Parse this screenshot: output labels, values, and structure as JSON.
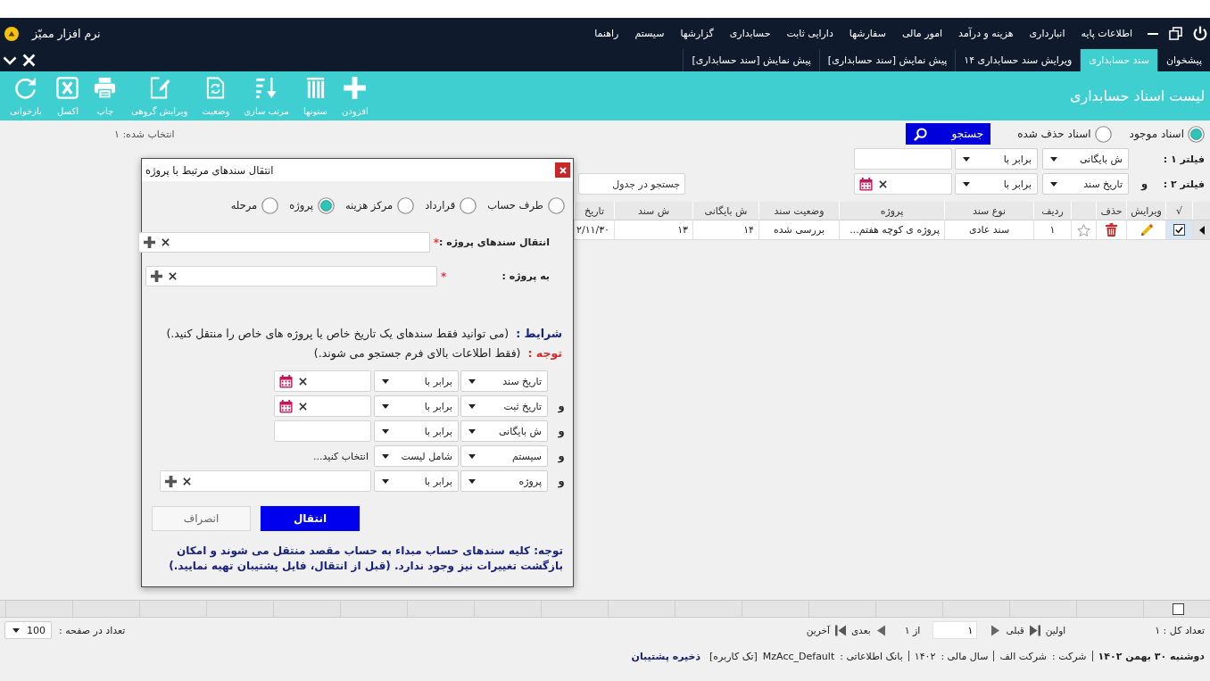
{
  "app": {
    "title": "نرم افزار ممیّز"
  },
  "menu": [
    "اطلاعات پایه",
    "انبارداری",
    "هزینه و درآمد",
    "امور مالی",
    "سفارشها",
    "دارایی ثابت",
    "حسابداری",
    "گزارشها",
    "سیستم",
    "راهنما"
  ],
  "tabs": [
    {
      "label": "پیشخوان",
      "selected": false
    },
    {
      "label": "سند حسابداری",
      "selected": true
    },
    {
      "label": "ویرایش سند حسابداری ۱۴",
      "selected": false
    },
    {
      "label": "پیش نمایش [سند حسابداری]",
      "selected": false
    },
    {
      "label": "پیش نمایش [سند حسابداری]",
      "selected": false
    }
  ],
  "toolbar": {
    "title": "لیست اسناد حسابداری",
    "buttons": [
      {
        "label": "افزودن",
        "kind": "add"
      },
      {
        "label": "ستونها",
        "kind": "columns"
      },
      {
        "label": "مرتب سازی",
        "kind": "sort"
      },
      {
        "label": "وضعیت",
        "kind": "status"
      },
      {
        "label": "ویرایش گروهی",
        "kind": "bulk-edit"
      },
      {
        "label": "چاپ",
        "kind": "print"
      },
      {
        "label": "اکسل",
        "kind": "excel"
      },
      {
        "label": "بازخوانی",
        "kind": "reload"
      }
    ]
  },
  "doc_filter": {
    "options": [
      {
        "label": "اسناد موجود",
        "selected": true
      },
      {
        "label": "اسناد حذف شده",
        "selected": false
      }
    ],
    "search_button": "جستجو",
    "selected_count": "انتخاب شده: ۱"
  },
  "filters": [
    {
      "label": "فیلتر ۱ :",
      "field": "ش بایگانی",
      "operator": "برابر با",
      "kind": "text"
    },
    {
      "label": "فیلتر ۲ :",
      "joiner": "و",
      "field": "تاریخ سند",
      "operator": "برابر با",
      "kind": "date"
    }
  ],
  "table_search": {
    "placeholder": "جستجو در جدول"
  },
  "table": {
    "columns": [
      "√",
      "ویرایش",
      "حذف",
      "",
      "ردیف",
      "نوع سند",
      "پروژه",
      "وضعیت سند",
      "ش بایگانی",
      "ش سند",
      "تاریخ"
    ],
    "rows": [
      {
        "current": true,
        "cells": [
          {
            "kind": "checkbox",
            "checked": true
          },
          {
            "kind": "edit"
          },
          {
            "kind": "delete"
          },
          {
            "kind": "star",
            "starred": false
          },
          "۱",
          "سند عادی",
          "پروژه ی کوچه هفتم...",
          "بررسی شده",
          "۱۴",
          "۱۳",
          "۲/۱۱/۳۰"
        ]
      }
    ],
    "footer_checkbox": {
      "checked": false
    }
  },
  "pager": {
    "total": "تعداد کل : ۱",
    "first": "اولین",
    "previous": "قبلی",
    "page": "۱",
    "page_count": "از ۱",
    "next": "بعدی",
    "last": "آخرین",
    "page_size_label": "تعداد در صفحه :",
    "page_size": "100"
  },
  "status_bar": {
    "date": "دوشنبه ۳۰ بهمن ۱۴۰۲",
    "fields": [
      {
        "label": "شرکت :",
        "value": "شرکت الف"
      },
      {
        "label": "سال مالی :",
        "value": "۱۴۰۲"
      },
      {
        "label": "بانک اطلاعاتی :",
        "value": "MzAcc_Default"
      }
    ],
    "mode": "[تک کاربره]",
    "backup_link": "ذخیره پشتیبان"
  },
  "dialog": {
    "title": "انتقال سندهای مرتبط با پروژه",
    "scope_options": [
      {
        "label": "طرف حساب",
        "selected": false
      },
      {
        "label": "قرارداد",
        "selected": false
      },
      {
        "label": "مرکز هزینه",
        "selected": false
      },
      {
        "label": "پروژه",
        "selected": true
      },
      {
        "label": "مرحله",
        "selected": false
      }
    ],
    "fields": [
      {
        "label": "انتقال سندهای پروژه :",
        "required_mark": "*"
      },
      {
        "label": "به پروژه :",
        "required_mark": "*"
      }
    ],
    "notes": [
      {
        "label": "شرایط :",
        "kind": "condition",
        "text": "(می توانید فقط سندهای یک تاریخ خاص یا پروژه های خاص را منتقل کنید.)"
      },
      {
        "label": "توجه :",
        "kind": "warning",
        "text": "(فقط اطلاعات بالای فرم جستجو می شوند.)"
      }
    ],
    "conditions": [
      {
        "field": "تاریخ سند",
        "operator": "برابر با",
        "kind": "date"
      },
      {
        "joiner": "و",
        "field": "تاریخ ثبت",
        "operator": "برابر با",
        "kind": "date"
      },
      {
        "joiner": "و",
        "field": "ش بایگانی",
        "operator": "برابر با",
        "kind": "text"
      },
      {
        "joiner": "و",
        "field": "سیستم",
        "operator": "شامل لیست",
        "kind": "list",
        "value": "انتخاب کنید..."
      },
      {
        "joiner": "و",
        "field": "پروژه",
        "operator": "برابر با",
        "kind": "lookup"
      }
    ],
    "buttons": [
      {
        "label": "انتقال",
        "kind": "primary"
      },
      {
        "label": "انصراف",
        "kind": "secondary"
      }
    ],
    "warning": "توجه: کلیه سندهای حساب مبداء به حساب مقصد منتقل می شوند و امکان بازگشت تغییرات نیز وجود ندارد. (قبل از انتقال، فایل پشتیبان تهیه نمایید.)"
  }
}
